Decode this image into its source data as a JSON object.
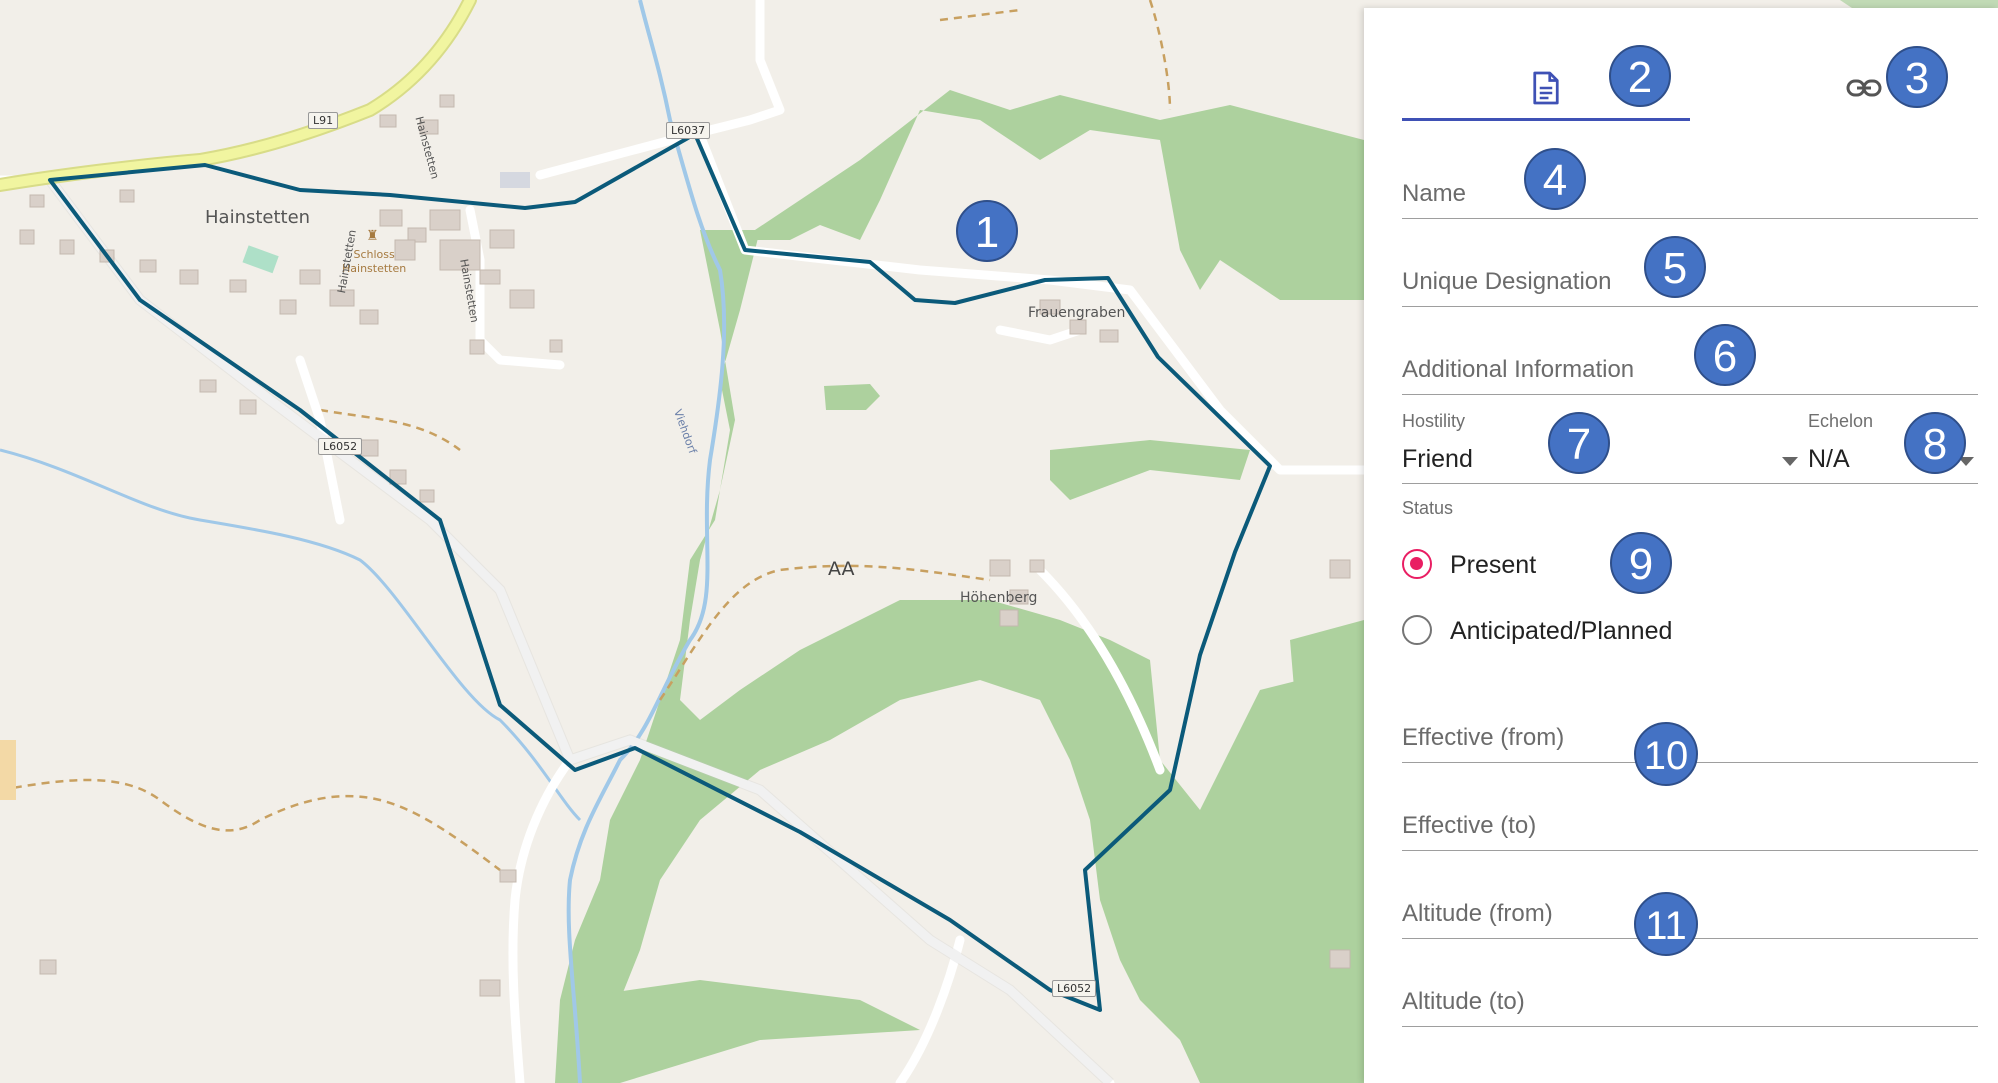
{
  "map": {
    "places": {
      "hainstetten": "Hainstetten",
      "schloss": "Schloss\nHainstetten",
      "frauengraben": "Frauengraben",
      "hohenberg": "Höhenberg",
      "area_label": "AA",
      "creek": "Viehdorf"
    },
    "roads": {
      "l91": "L91",
      "l6037": "L6037",
      "l6052_a": "L6052",
      "l6052_b": "L6052",
      "street_1": "Hainstetten",
      "street_2": "Hainstetten",
      "street_3": "Hainstetten"
    },
    "colors": {
      "background": "#f2efe9",
      "forest": "#add19e",
      "polygon_outline": "#0b5a7a",
      "water": "#a0c8e8",
      "main_road": "#f1f5a0"
    }
  },
  "annotations": [
    "1",
    "2",
    "3",
    "4",
    "5",
    "6",
    "7",
    "8",
    "9",
    "10",
    "11"
  ],
  "panel": {
    "tabs": [
      {
        "icon": "document-icon"
      },
      {
        "icon": "link-icon"
      }
    ],
    "fields": {
      "name": "Name",
      "unique_designation": "Unique Designation",
      "additional_information": "Additional Information",
      "effective_from": "Effective (from)",
      "effective_to": "Effective (to)",
      "altitude_from": "Altitude (from)",
      "altitude_to": "Altitude (to)"
    },
    "hostility": {
      "label": "Hostility",
      "value": "Friend"
    },
    "echelon": {
      "label": "Echelon",
      "value": "N/A"
    },
    "status": {
      "label": "Status",
      "options": [
        {
          "label": "Present",
          "selected": true
        },
        {
          "label": "Anticipated/Planned",
          "selected": false
        }
      ]
    },
    "colors": {
      "accent": "#3f51b5",
      "radio_selected": "#e91e63"
    }
  }
}
